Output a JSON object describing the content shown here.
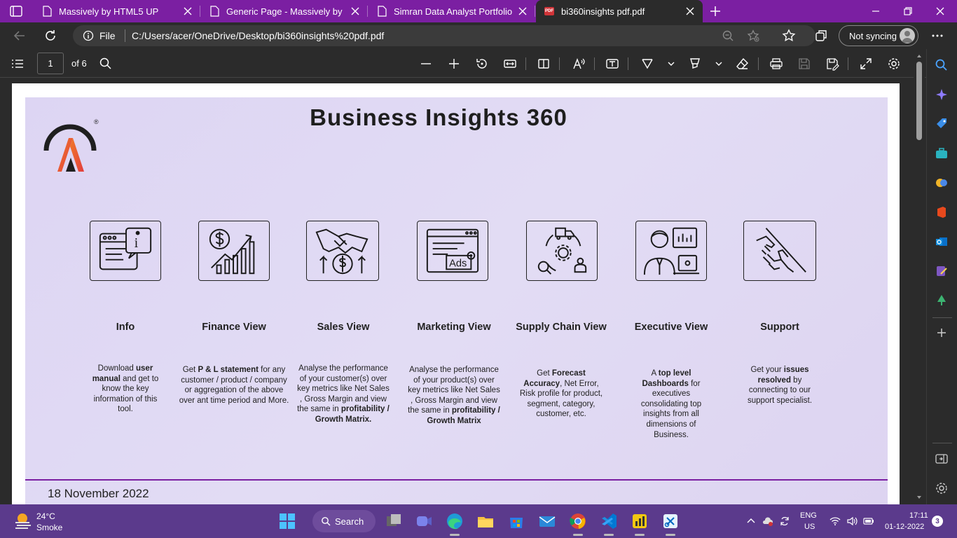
{
  "tabs": [
    {
      "label": "Massively by HTML5 UP",
      "icon": "document-icon",
      "active": false
    },
    {
      "label": "Generic Page - Massively by HTM",
      "icon": "document-icon",
      "active": false
    },
    {
      "label": "Simran Data Analyst Portfolio",
      "icon": "document-icon",
      "active": false
    },
    {
      "label": "bi360insights pdf.pdf",
      "icon": "pdf-icon",
      "active": true
    }
  ],
  "pdf_badge": "PDF",
  "address": {
    "info_label": "File",
    "url": "C:/Users/acer/OneDrive/Desktop/bi360insights%20pdf.pdf",
    "sync_label": "Not syncing"
  },
  "pdf_toolbar": {
    "page_number": "1",
    "page_count": "of 6"
  },
  "slide": {
    "title": "Business Insights 360",
    "logo_mark": "®",
    "footer_date": "18 November 2022",
    "accent": "#7b1fa2",
    "cards": [
      {
        "title": "Info",
        "icon": "info-window-icon",
        "desc": [
          "Download ",
          "user manual",
          " and get to know the key information of this tool."
        ]
      },
      {
        "title": "Finance View",
        "icon": "finance-growth-icon",
        "desc": [
          "Get ",
          "P & L statement",
          " for any customer / product / company or aggregation of the above over ant time period and More."
        ]
      },
      {
        "title": "Sales View",
        "icon": "handshake-dollar-icon",
        "desc": [
          "Analyse the performance of your customer(s) over key metrics like Net Sales , Gross Margin and view the same in ",
          "profitability / Growth Matrix.",
          ""
        ]
      },
      {
        "title": "Marketing View",
        "icon": "ads-browser-icon",
        "desc": [
          "Analyse the performance of your product(s) over key metrics like Net Sales , Gross Margin and view the same in ",
          "profitability / Growth Matrix",
          ""
        ]
      },
      {
        "title": "Supply Chain View",
        "icon": "supply-chain-icon",
        "desc": [
          "Get ",
          "Forecast Accuracy",
          ", Net Error, Risk profile for product, segment, category, customer, etc."
        ]
      },
      {
        "title": "Executive View",
        "icon": "executive-icon",
        "desc": [
          "A ",
          "top level Dashboards",
          " for executives consolidating top insights from all dimensions of Business."
        ]
      },
      {
        "title": "Support",
        "icon": "helping-hand-icon",
        "desc": [
          "Get your ",
          "issues resolved",
          " by connecting to our support specialist."
        ]
      }
    ]
  },
  "taskbar": {
    "temperature": "24°C",
    "weather": "Smoke",
    "search_label": "Search",
    "lang_line1": "ENG",
    "lang_line2": "US",
    "time": "17:11",
    "date": "01-12-2022",
    "notification_count": "3"
  }
}
